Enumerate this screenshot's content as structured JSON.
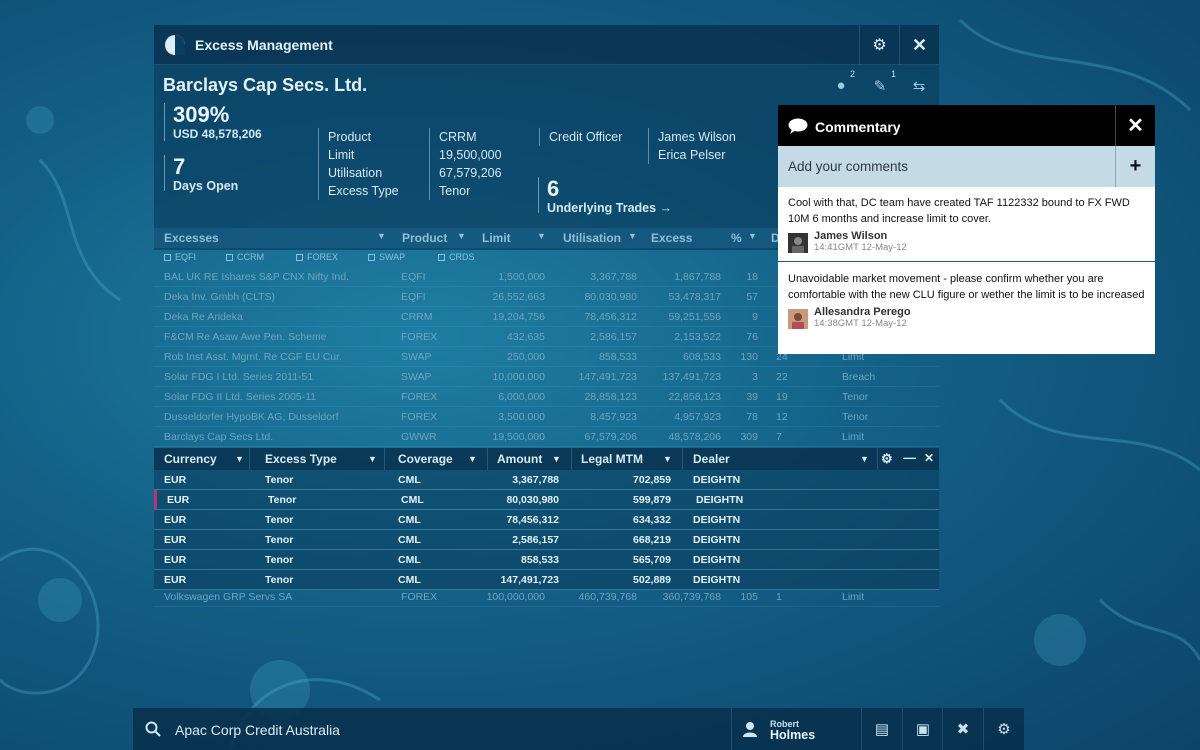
{
  "app": {
    "title": "Excess Management"
  },
  "header": {
    "company": "Barclays Cap Secs. Ltd.",
    "comment_count": "2",
    "edit_count": "1"
  },
  "summary": {
    "excess_pct": "309%",
    "excess_amount": "USD 48,578,206",
    "days_open_value": "7",
    "days_open_label": "Days Open",
    "labels": [
      "Product",
      "Limit",
      "Utilisation",
      "Excess Type"
    ],
    "values": [
      "CRRM",
      "19,500,000",
      "67,579,206",
      "Tenor"
    ],
    "credit_officer_label": "Credit Officer",
    "credit_officers": [
      "James Wilson",
      "Erica Pelser"
    ],
    "underlying_trades_value": "6",
    "underlying_trades_label": "Underlying Trades →"
  },
  "excesses_grid": {
    "headers": [
      "Excesses",
      "Product",
      "Limit",
      "Utilisation",
      "Excess",
      "%",
      "D"
    ],
    "filters": [
      "EQFI",
      "CCRM",
      "FOREX",
      "SWAP",
      "CRDS"
    ],
    "rows": [
      [
        "BAL UK RE Ishares S&P CNX Nifty Ind.",
        "EQFI",
        "1,500,000",
        "3,367,788",
        "1,867,788",
        "18",
        "",
        ""
      ],
      [
        "Deka Inv. Gmbh (CLTS)",
        "EQFI",
        "26,552,663",
        "80,030,980",
        "53,478,317",
        "57",
        "",
        ""
      ],
      [
        "Deka Re Arideka",
        "CRRM",
        "19,204,756",
        "78,456,312",
        "59,251,556",
        "9",
        "",
        ""
      ],
      [
        "F&CM Re Asaw Awe Pen. Scheme",
        "FOREX",
        "432,635",
        "2,586,157",
        "2,153,522",
        "76",
        "",
        ""
      ],
      [
        "Rob Inst Asst. Mgmt. Re CGF EU Cur.",
        "SWAP",
        "250,000",
        "858,533",
        "608,533",
        "130",
        "24",
        "Limit"
      ],
      [
        "Solar FDG I Ltd. Series 2011-51",
        "SWAP",
        "10,000,000",
        "147,491,723",
        "137,491,723",
        "3",
        "22",
        "Breach"
      ],
      [
        "Solar FDG II Ltd. Series 2005-11",
        "FOREX",
        "6,000,000",
        "28,858,123",
        "22,858,123",
        "39",
        "19",
        "Tenor"
      ],
      [
        "Dusseldorfer HypoBK AG, Dusseldorf",
        "FOREX",
        "3,500,000",
        "8,457,923",
        "4,957,923",
        "78",
        "12",
        "Tenor"
      ],
      [
        "Barclays Cap Secs Ltd.",
        "GWWR",
        "19,500,000",
        "67,579,206",
        "48,578,206",
        "309",
        "7",
        "Limit"
      ]
    ],
    "footer_row": [
      "Volkswagen GRP Servs SA",
      "FOREX",
      "100,000,000",
      "460,739,768",
      "360,739,768",
      "105",
      "1",
      "Limit"
    ]
  },
  "detail_grid": {
    "headers": [
      "Currency",
      "Excess Type",
      "Coverage",
      "Amount",
      "Legal MTM",
      "Dealer"
    ],
    "rows": [
      [
        "EUR",
        "Tenor",
        "CML",
        "3,367,788",
        "702,859",
        "DEIGHTN"
      ],
      [
        "EUR",
        "Tenor",
        "CML",
        "80,030,980",
        "599,879",
        "DEIGHTN"
      ],
      [
        "EUR",
        "Tenor",
        "CML",
        "78,456,312",
        "634,332",
        "DEIGHTN"
      ],
      [
        "EUR",
        "Tenor",
        "CML",
        "2,586,157",
        "668,219",
        "DEIGHTN"
      ],
      [
        "EUR",
        "Tenor",
        "CML",
        "858,533",
        "565,709",
        "DEIGHTN"
      ],
      [
        "EUR",
        "Tenor",
        "CML",
        "147,491,723",
        "502,889",
        "DEIGHTN"
      ]
    ]
  },
  "commentary": {
    "title": "Commentary",
    "add_placeholder": "Add your comments",
    "comments": [
      {
        "text": "Cool with that, DC team have created TAF 1122332 bound to FX FWD 10M 6 months and increase limit to cover.",
        "author": "James Wilson",
        "time": "14:41GMT 12-May-12"
      },
      {
        "text": "Unavoidable market movement - please confirm whether you are comfortable with the new CLU figure or wether the limit is to be increased",
        "author": "Allesandra Perego",
        "time": "14:38GMT 12-May-12"
      }
    ]
  },
  "bottom_bar": {
    "search_value": "Apac Corp Credit Australia",
    "user_first": "Robert",
    "user_last": "Holmes"
  },
  "colors": {
    "background": "#135f86",
    "panel": "#0a3e60",
    "commentary_header": "#020202",
    "commentary_add": "#c4dbe5"
  }
}
